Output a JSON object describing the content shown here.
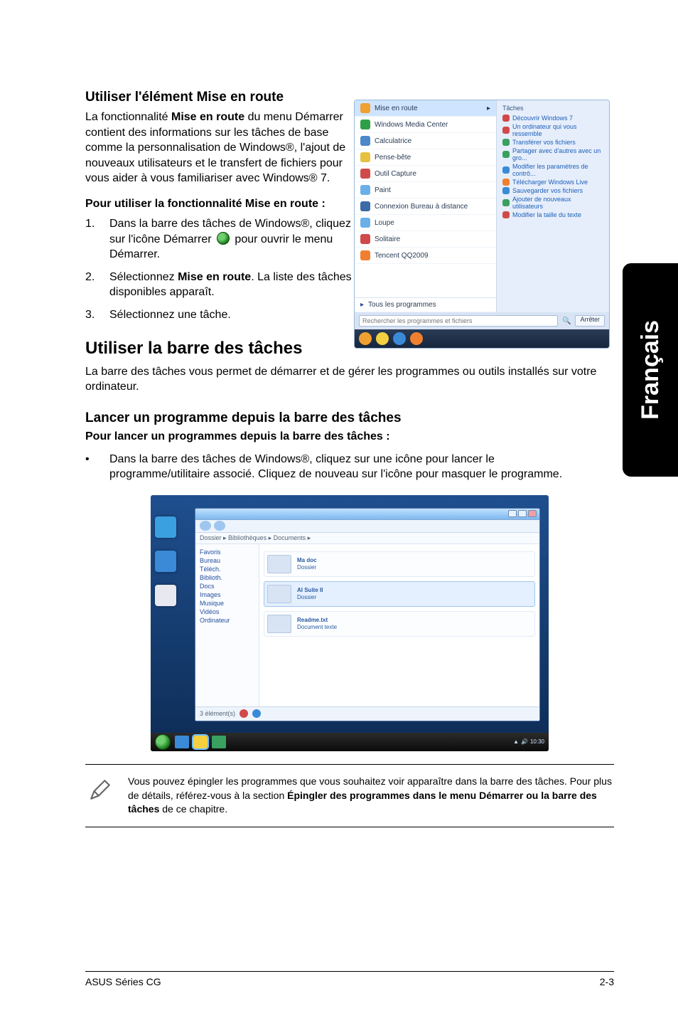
{
  "side_tab": "Français",
  "section1": {
    "title": "Utiliser l'élément Mise en route",
    "intro_parts": [
      "La fonctionnalité ",
      "Mise en route",
      " du menu Démarrer contient des informations sur les tâches de base comme la personnalisation de Windows®, l'ajout de nouveaux utilisateurs et le transfert de fichiers pour vous aider à vous familiariser avec Windows® 7."
    ],
    "howto": "Pour utiliser la fonctionnalité Mise en route :",
    "steps": [
      {
        "n": "1.",
        "pre": "Dans la barre des tâches de Windows®, cliquez sur l'icône Démarrer ",
        "post": " pour ouvrir le menu Démarrer."
      },
      {
        "n": "2.",
        "pre": "Sélectionnez ",
        "bold": "Mise en route",
        "post": ". La liste des tâches disponibles apparaît."
      },
      {
        "n": "3.",
        "pre": "Sélectionnez une tâche."
      }
    ]
  },
  "section2": {
    "title": "Utiliser la barre des tâches",
    "intro": "La barre des tâches vous permet de démarrer et de gérer les programmes ou outils installés sur votre ordinateur."
  },
  "section3": {
    "title": "Lancer un programme depuis la barre des tâches",
    "howto": "Pour lancer un programmes depuis la barre des tâches :",
    "bullet": "Dans la barre des tâches de Windows®, cliquez sur une icône pour lancer le programme/utilitaire associé. Cliquez de nouveau sur l'icône pour masquer le programme."
  },
  "start_menu": {
    "left_items": [
      {
        "label": "Mise en route",
        "color": "#f0a030",
        "hl": true,
        "arrow": "▸"
      },
      {
        "label": "Windows Media Center",
        "color": "#2fa04a"
      },
      {
        "label": "Calculatrice",
        "color": "#4a88c8"
      },
      {
        "label": "Pense-bête",
        "color": "#e8c040"
      },
      {
        "label": "Outil Capture",
        "color": "#d04a4a"
      },
      {
        "label": "Paint",
        "color": "#6ab0e8"
      },
      {
        "label": "Connexion Bureau à distance",
        "color": "#3a6aa8"
      },
      {
        "label": "Loupe",
        "color": "#6ab0e8"
      },
      {
        "label": "Solitaire",
        "color": "#d04a4a"
      },
      {
        "label": "Tencent QQ2009",
        "color": "#f08030"
      }
    ],
    "all_programs": "Tous les programmes",
    "search_placeholder": "Rechercher les programmes et fichiers",
    "shutdown": "Arrêter",
    "right_header": "Tâches",
    "right_links": [
      "Découvrir Windows 7",
      "Un ordinateur qui vous ressemble",
      "Transférer vos fichiers",
      "Partager avec d'autres avec un gro...",
      "Modifier les paramètres de contrô...",
      "Télécharger Windows Live",
      "Sauvegarder vos fichiers",
      "Ajouter de nouveaux utilisateurs",
      "Modifier la taille du texte"
    ],
    "orbs": [
      "#f0a030",
      "#f4d040",
      "#3a8ad8",
      "#f08030"
    ]
  },
  "task_window": {
    "addr": "Dossier ▸  Bibliothèques ▸  Documents  ▸",
    "sidebar": [
      "Favoris",
      "Bureau",
      "Téléch.",
      "Biblioth.",
      "Docs",
      "Images",
      "Musique",
      "Vidéos",
      "Ordinateur"
    ],
    "rows": [
      {
        "title": "Ma doc",
        "sub": "Dossier",
        "sel": false
      },
      {
        "title": "AI Suite II",
        "sub": "Dossier",
        "sel": true
      },
      {
        "title": "Readme.txt",
        "sub": "Document texte",
        "sel": false
      }
    ],
    "status_text": "3 élément(s)",
    "taskbar_icons": [
      "#3a8ad8",
      "#f4d040",
      "#3aa060"
    ],
    "tray_time": "10:30"
  },
  "note": {
    "text_parts": [
      "Vous pouvez épingler les programmes que vous souhaitez voir apparaître dans la barre des tâches. Pour plus de détails, référez-vous à la section ",
      "Épingler des programmes dans le menu Démarrer ou la barre des tâches",
      " de ce chapitre."
    ]
  },
  "footer": {
    "left": "ASUS Séries CG",
    "right": "2-3"
  }
}
